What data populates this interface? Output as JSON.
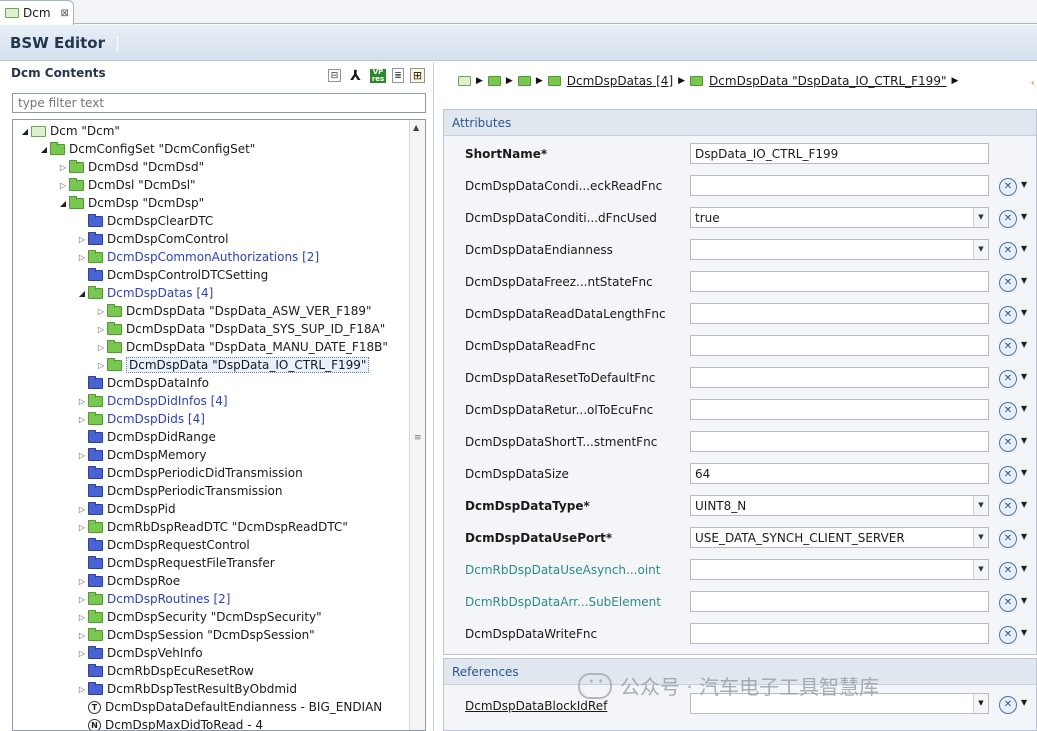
{
  "tab": {
    "label": "Dcm",
    "close": "⊠"
  },
  "editor": {
    "title": "BSW Editor"
  },
  "left": {
    "title": "Dcm Contents",
    "filter_placeholder": "type filter text",
    "tools": {
      "collapse": "⊟",
      "tree": "⅄",
      "vp_top": "VP",
      "vp_bottom": "res",
      "doc": "≣",
      "grid": "⊞"
    }
  },
  "tree": [
    {
      "label": "Dcm \"Dcm\"",
      "level": 0,
      "icon": "module",
      "toggle": "open",
      "color": "normal"
    },
    {
      "label": "DcmConfigSet \"DcmConfigSet\"",
      "level": 1,
      "icon": "green",
      "toggle": "open",
      "color": "normal"
    },
    {
      "label": "DcmDsd \"DcmDsd\"",
      "level": 2,
      "icon": "green",
      "toggle": "closed",
      "color": "normal"
    },
    {
      "label": "DcmDsl \"DcmDsl\"",
      "level": 2,
      "icon": "green",
      "toggle": "closed",
      "color": "normal"
    },
    {
      "label": "DcmDsp \"DcmDsp\"",
      "level": 2,
      "icon": "green",
      "toggle": "open",
      "color": "normal"
    },
    {
      "label": "DcmDspClearDTC",
      "level": 3,
      "icon": "blue",
      "toggle": "none",
      "color": "normal"
    },
    {
      "label": "DcmDspComControl",
      "level": 3,
      "icon": "blue",
      "toggle": "closed",
      "color": "normal"
    },
    {
      "label": "DcmDspCommonAuthorizations [2]",
      "level": 3,
      "icon": "green",
      "toggle": "closed",
      "color": "blue"
    },
    {
      "label": "DcmDspControlDTCSetting",
      "level": 3,
      "icon": "blue",
      "toggle": "none",
      "color": "normal"
    },
    {
      "label": "DcmDspDatas [4]",
      "level": 3,
      "icon": "green",
      "toggle": "open",
      "color": "blue"
    },
    {
      "label": "DcmDspData \"DspData_ASW_VER_F189\"",
      "level": 4,
      "icon": "green",
      "toggle": "closed",
      "color": "normal"
    },
    {
      "label": "DcmDspData \"DspData_SYS_SUP_ID_F18A\"",
      "level": 4,
      "icon": "green",
      "toggle": "closed",
      "color": "normal"
    },
    {
      "label": "DcmDspData \"DspData_MANU_DATE_F18B\"",
      "level": 4,
      "icon": "green",
      "toggle": "closed",
      "color": "normal"
    },
    {
      "label": "DcmDspData \"DspData_IO_CTRL_F199\"",
      "level": 4,
      "icon": "green",
      "toggle": "closed",
      "color": "normal",
      "selected": true
    },
    {
      "label": "DcmDspDataInfo",
      "level": 3,
      "icon": "blue",
      "toggle": "none",
      "color": "normal"
    },
    {
      "label": "DcmDspDidInfos [4]",
      "level": 3,
      "icon": "green",
      "toggle": "closed",
      "color": "blue"
    },
    {
      "label": "DcmDspDids [4]",
      "level": 3,
      "icon": "green",
      "toggle": "closed",
      "color": "blue"
    },
    {
      "label": "DcmDspDidRange",
      "level": 3,
      "icon": "blue",
      "toggle": "none",
      "color": "normal"
    },
    {
      "label": "DcmDspMemory",
      "level": 3,
      "icon": "blue",
      "toggle": "closed",
      "color": "normal"
    },
    {
      "label": "DcmDspPeriodicDidTransmission",
      "level": 3,
      "icon": "blue",
      "toggle": "none",
      "color": "normal"
    },
    {
      "label": "DcmDspPeriodicTransmission",
      "level": 3,
      "icon": "blue",
      "toggle": "none",
      "color": "normal"
    },
    {
      "label": "DcmDspPid",
      "level": 3,
      "icon": "blue",
      "toggle": "closed",
      "color": "normal"
    },
    {
      "label": "DcmRbDspReadDTC \"DcmDspReadDTC\"",
      "level": 3,
      "icon": "green",
      "toggle": "closed",
      "color": "normal"
    },
    {
      "label": "DcmDspRequestControl",
      "level": 3,
      "icon": "blue",
      "toggle": "none",
      "color": "normal"
    },
    {
      "label": "DcmDspRequestFileTransfer",
      "level": 3,
      "icon": "blue",
      "toggle": "none",
      "color": "normal"
    },
    {
      "label": "DcmDspRoe",
      "level": 3,
      "icon": "blue",
      "toggle": "closed",
      "color": "normal"
    },
    {
      "label": "DcmDspRoutines [2]",
      "level": 3,
      "icon": "green",
      "toggle": "closed",
      "color": "blue"
    },
    {
      "label": "DcmDspSecurity \"DcmDspSecurity\"",
      "level": 3,
      "icon": "green",
      "toggle": "closed",
      "color": "normal"
    },
    {
      "label": "DcmDspSession \"DcmDspSession\"",
      "level": 3,
      "icon": "green",
      "toggle": "closed",
      "color": "normal"
    },
    {
      "label": "DcmDspVehInfo",
      "level": 3,
      "icon": "blue",
      "toggle": "closed",
      "color": "normal"
    },
    {
      "label": "DcmRbDspEcuResetRow",
      "level": 3,
      "icon": "blue",
      "toggle": "none",
      "color": "normal"
    },
    {
      "label": "DcmRbDspTestResultByObdmid",
      "level": 3,
      "icon": "blue",
      "toggle": "closed",
      "color": "normal"
    },
    {
      "label": "DcmDspDataDefaultEndianness - BIG_ENDIAN",
      "level": 3,
      "icon": "T",
      "toggle": "none",
      "color": "normal"
    },
    {
      "label": "DcmDspMaxDidToRead - 4",
      "level": 3,
      "icon": "N",
      "toggle": "none",
      "color": "normal"
    }
  ],
  "breadcrumb": {
    "items": [
      "DcmDspDatas [4]",
      "DcmDspData \"DspData_IO_CTRL_F199\""
    ],
    "more": "‹"
  },
  "attributes": {
    "title": "Attributes",
    "rows": [
      {
        "name": "ShortName*",
        "value": "DspData_IO_CTRL_F199",
        "style": "bold",
        "combo": false,
        "clear": false
      },
      {
        "name": "DcmDspDataCondi...eckReadFnc",
        "value": "",
        "style": "normal",
        "combo": false,
        "clear": true
      },
      {
        "name": "DcmDspDataConditi...dFncUsed",
        "value": "true",
        "style": "normal",
        "combo": true,
        "clear": true
      },
      {
        "name": "DcmDspDataEndianness",
        "value": "",
        "style": "normal",
        "combo": true,
        "clear": true
      },
      {
        "name": "DcmDspDataFreez...ntStateFnc",
        "value": "",
        "style": "normal",
        "combo": false,
        "clear": true
      },
      {
        "name": "DcmDspDataReadDataLengthFnc",
        "value": "",
        "style": "normal",
        "combo": false,
        "clear": true
      },
      {
        "name": "DcmDspDataReadFnc",
        "value": "",
        "style": "normal",
        "combo": false,
        "clear": true
      },
      {
        "name": "DcmDspDataResetToDefaultFnc",
        "value": "",
        "style": "normal",
        "combo": false,
        "clear": true
      },
      {
        "name": "DcmDspDataRetur...olToEcuFnc",
        "value": "",
        "style": "normal",
        "combo": false,
        "clear": true
      },
      {
        "name": "DcmDspDataShortT...stmentFnc",
        "value": "",
        "style": "normal",
        "combo": false,
        "clear": true
      },
      {
        "name": "DcmDspDataSize",
        "value": "64",
        "style": "normal",
        "combo": false,
        "clear": true
      },
      {
        "name": "DcmDspDataType*",
        "value": "UINT8_N",
        "style": "bold",
        "combo": true,
        "clear": true
      },
      {
        "name": "DcmDspDataUsePort*",
        "value": "USE_DATA_SYNCH_CLIENT_SERVER",
        "style": "bold",
        "combo": true,
        "clear": true
      },
      {
        "name": "DcmRbDspDataUseAsynch...oint",
        "value": "",
        "style": "teal",
        "combo": true,
        "clear": true
      },
      {
        "name": "DcmRbDspDataArr...SubElement",
        "value": "",
        "style": "teal",
        "combo": false,
        "clear": true
      },
      {
        "name": "DcmDspDataWriteFnc",
        "value": "",
        "style": "normal",
        "combo": false,
        "clear": true
      }
    ]
  },
  "references": {
    "title": "References",
    "rows": [
      {
        "name": "DcmDspDataBlockIdRef",
        "value": ""
      }
    ]
  },
  "watermark": "公众号 · 汽车电子工具智慧库"
}
